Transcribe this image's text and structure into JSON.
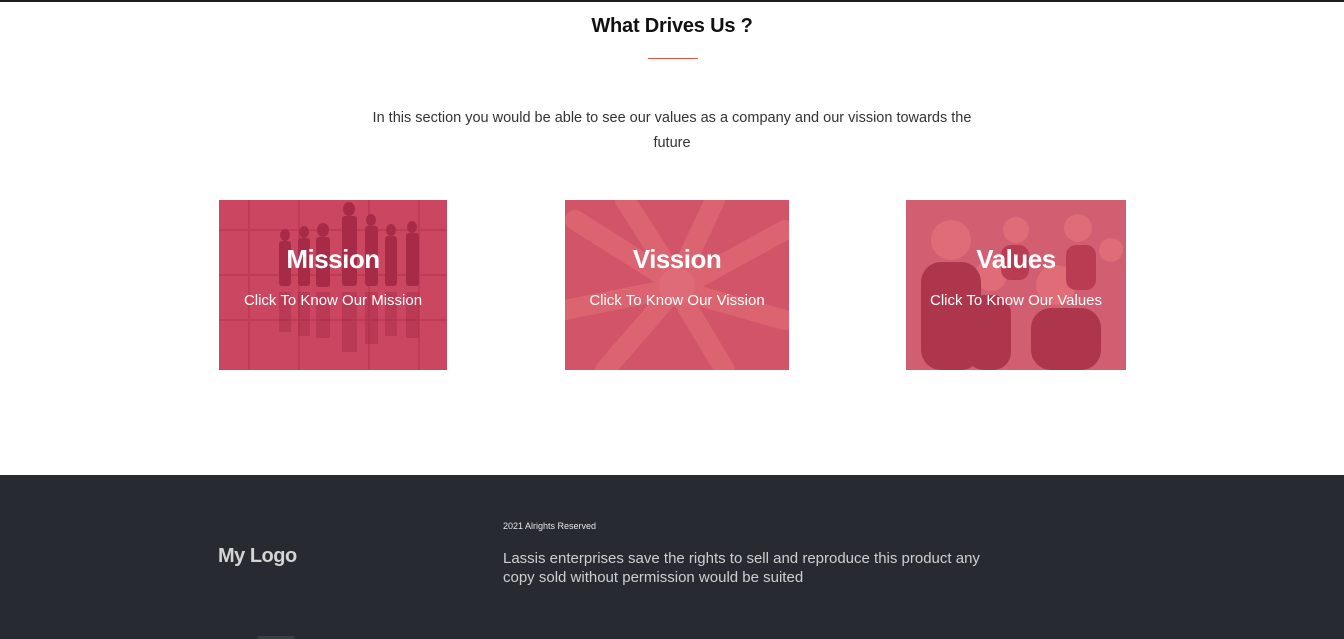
{
  "section": {
    "title": "What Drives Us ?",
    "intro": "In this section you would be able to see our values as a company and our vission towards the future"
  },
  "cards": [
    {
      "title": "Mission",
      "link": "Click To Know Our Mission"
    },
    {
      "title": "Vission",
      "link": "Click To Know Our Vission"
    },
    {
      "title": "Values",
      "link": "Click To Know Our Values"
    }
  ],
  "footer": {
    "logo": "My Logo",
    "rights": "2021 Alrights Reserved",
    "description": "Lassis enterprises save the rights to sell and reproduce this product any copy sold without permission would be suited"
  },
  "colors": {
    "accent": "#e0543f",
    "card_overlay": "#d63452",
    "footer_bg": "#272a31"
  }
}
